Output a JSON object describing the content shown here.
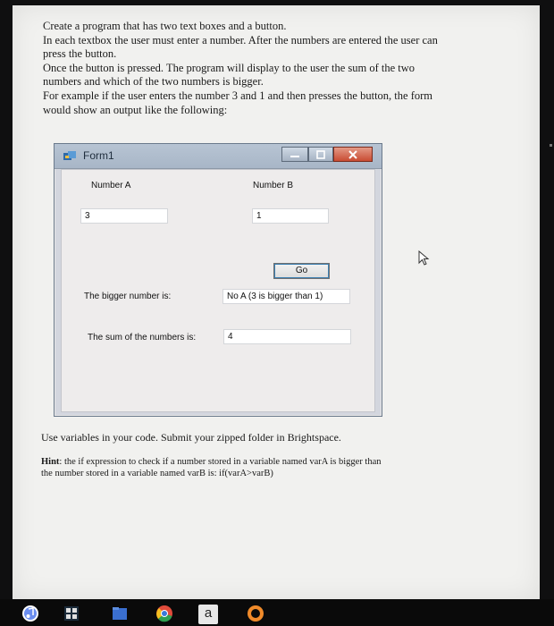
{
  "instructions": {
    "lines": [
      "Create a program that has two text boxes and a button.",
      "In each textbox the user must enter a number.  After the numbers are entered the user can",
      "press the button.",
      "Once the button is pressed.  The program will display to the user the sum of the two",
      "numbers and which of the two numbers is bigger.",
      "For example if the user enters the number 3 and 1 and then presses the button, the form",
      "would show an output like the following:"
    ]
  },
  "window": {
    "title": "Form1",
    "labels": {
      "number_a": "Number A",
      "number_b": "Number B",
      "bigger": "The bigger number is:",
      "sum": "The sum of the numbers is:"
    },
    "inputs": {
      "number_a_value": "3",
      "number_b_value": "1"
    },
    "outputs": {
      "bigger_value": "No A (3 is bigger than 1)",
      "sum_value": "4"
    },
    "go_button": "Go"
  },
  "footer": {
    "line1": "Use variables in your code. Submit your zipped folder in Brightspace.",
    "hint_label": "Hint",
    "hint_line1_rest": ": the if expression to check if a number stored in a variable named varA is bigger than",
    "hint_line2": "the number stored in a variable named varB is: if(varA>varB)"
  },
  "taskbar": {
    "icons": [
      "itunes-icon",
      "calculator-icon",
      "folder-icon",
      "chrome-icon",
      "text-app-icon",
      "browser-icon"
    ],
    "letter_tile": "a"
  },
  "colors": {
    "close_button": "#c94c33",
    "title_bar": "#b7c4d3",
    "go_focus_border": "#3c7fb1"
  }
}
